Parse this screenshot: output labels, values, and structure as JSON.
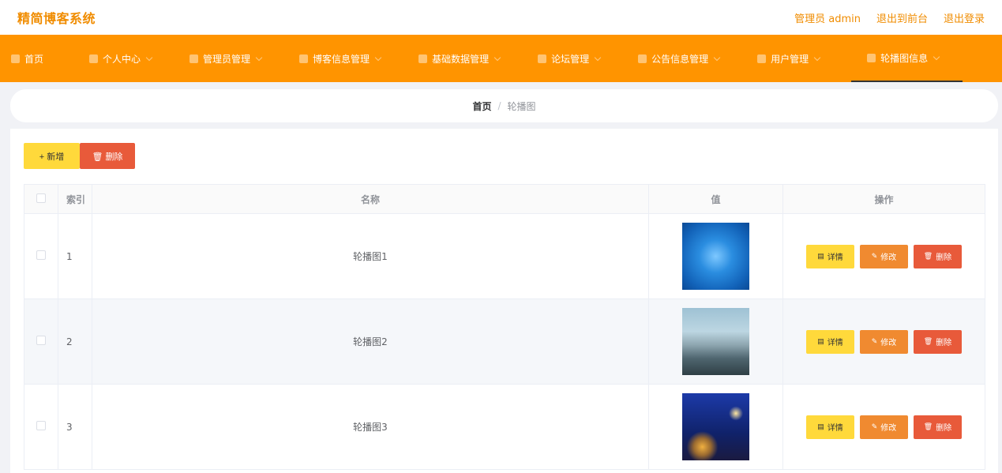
{
  "header": {
    "brand": "精简博客系统",
    "admin_label": "管理员 admin",
    "back_front_label": "退出到前台",
    "logout_label": "退出登录"
  },
  "nav": {
    "items": [
      {
        "label": "首页",
        "icon": "home-icon"
      },
      {
        "label": "个人中心",
        "icon": "user-icon"
      },
      {
        "label": "管理员管理",
        "icon": "chat-icon"
      },
      {
        "label": "博客信息管理",
        "icon": "grid-icon"
      },
      {
        "label": "基础数据管理",
        "icon": "folder-icon"
      },
      {
        "label": "论坛管理",
        "icon": "plane-icon"
      },
      {
        "label": "公告信息管理",
        "icon": "list-icon"
      },
      {
        "label": "用户管理",
        "icon": "mail-icon"
      },
      {
        "label": "轮播图信息",
        "icon": "edit-icon"
      }
    ],
    "active_index": 8
  },
  "breadcrumb": {
    "home": "首页",
    "separator": "/",
    "current": "轮播图"
  },
  "toolbar": {
    "add_label": "+ 新增",
    "delete_label": "🗑 删除"
  },
  "table": {
    "headers": [
      "索引",
      "名称",
      "值",
      "操作"
    ],
    "rows": [
      {
        "index": "1",
        "name": "轮播图1",
        "image": "blue-globe"
      },
      {
        "index": "2",
        "name": "轮播图2",
        "image": "mountain-mist"
      },
      {
        "index": "3",
        "name": "轮播图3",
        "image": "city-bokeh"
      }
    ],
    "actions": {
      "detail": "详情",
      "edit": "修改",
      "delete": "删除"
    }
  },
  "colors": {
    "brand": "#f08c00",
    "nav_bg": "#ff9400",
    "detail_btn": "#ffd93b",
    "edit_btn": "#f08a30",
    "delete_btn": "#e85a3a"
  }
}
